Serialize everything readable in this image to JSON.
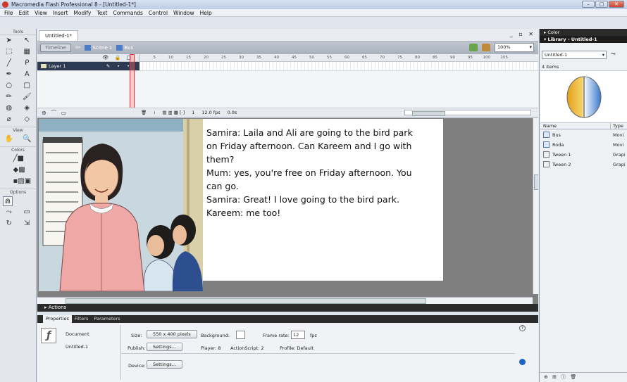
{
  "window": {
    "title": "Macromedia Flash Professional 8 - [Untitled-1*]",
    "controls": [
      "–",
      "□",
      "✕"
    ]
  },
  "menu": [
    "File",
    "Edit",
    "View",
    "Insert",
    "Modify",
    "Text",
    "Commands",
    "Control",
    "Window",
    "Help"
  ],
  "tools": {
    "header": "Tools",
    "view_label": "View",
    "colors_label": "Colors",
    "options_label": "Options"
  },
  "document": {
    "tab": "Untitled-1*",
    "win_controls": "_ ▫ ✕",
    "timeline_button": "Timeline",
    "scene": "Scene 1",
    "symbol": "Bus",
    "zoom": "100%"
  },
  "timeline": {
    "frame_numbers": [
      "5",
      "10",
      "15",
      "20",
      "25",
      "30",
      "35",
      "40",
      "45",
      "50",
      "55",
      "60",
      "65",
      "70",
      "75",
      "80",
      "85",
      "90",
      "95",
      "100",
      "105"
    ],
    "header_icons": "👁 🔒 □",
    "layer_name": "Layer 1",
    "layer_marks": "✎ • •",
    "current_frame": "1",
    "frame_rate": "12.0 fps",
    "time": "0.0s"
  },
  "stage": {
    "lines": [
      "Samira: Laila and Ali are going to the bird park",
      "on Friday afternoon. Can Kareem and I go with",
      "them?",
      "Mum: yes, you're free on Friday afternoon. You",
      "can go.",
      "Samira: Great! I love going to the bird park.",
      "Kareem: me too!"
    ]
  },
  "actions": {
    "label": "▸ Actions"
  },
  "properties": {
    "tabs": [
      "Properties",
      "Filters",
      "Parameters"
    ],
    "doc_label": "Document",
    "doc_name": "Untitled-1",
    "size_label": "Size:",
    "size_value": "550 x 400 pixels",
    "background_label": "Background:",
    "frame_rate_label": "Frame rate:",
    "frame_rate": "12",
    "fps": "fps",
    "publish_label": "Publish:",
    "settings_button": "Settings...",
    "player": "Player: 8",
    "actionscript": "ActionScript: 2",
    "profile": "Profile: Default",
    "device_label": "Device:",
    "device_button": "Settings...",
    "help": "?"
  },
  "right_panel": {
    "color_header": "▸ Color",
    "library_header": "▾ Library - Untitled-1",
    "library_select": "Untitled-1",
    "items_count": "4 items",
    "col_name": "Name",
    "col_type": "Type",
    "items": [
      {
        "name": "Bus",
        "type": "Movi",
        "kind": "movie"
      },
      {
        "name": "Roda",
        "type": "Movi",
        "kind": "movie"
      },
      {
        "name": "Tween 1",
        "type": "Grapi",
        "kind": "graphic"
      },
      {
        "name": "Tween 2",
        "type": "Grapi",
        "kind": "graphic"
      }
    ],
    "footer_icons": "⊕ ⊞ ⓘ 🗑"
  },
  "colors": {
    "accent_dark": "#2b2b2b",
    "layer_selected": "#2c3a52",
    "playhead": "#dd3333"
  }
}
